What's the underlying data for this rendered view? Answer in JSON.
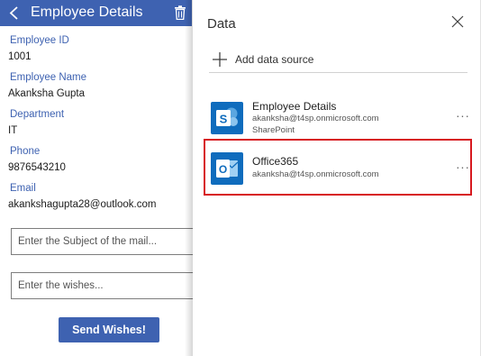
{
  "app": {
    "title": "Employee Details",
    "fields": [
      {
        "label": "Employee ID",
        "value": "1001"
      },
      {
        "label": "Employee Name",
        "value": "Akanksha Gupta"
      },
      {
        "label": "Department",
        "value": "IT"
      },
      {
        "label": "Phone",
        "value": "9876543210"
      },
      {
        "label": "Email",
        "value": "akankshagupta28@outlook.com"
      }
    ],
    "subject_input": {
      "placeholder": "Enter the Subject of the mail...",
      "value": ""
    },
    "wishes_input": {
      "placeholder": "Enter the wishes...",
      "value": ""
    },
    "send_button": "Send Wishes!",
    "header_color": "#3e62b1"
  },
  "panel": {
    "title": "Data",
    "add_source_label": "Add data source",
    "sources": [
      {
        "name": "Employee Details",
        "account": "akanksha@t4sp.onmicrosoft.com",
        "type": "SharePoint",
        "icon": "sharepoint-icon",
        "more": "···"
      },
      {
        "name": "Office365",
        "account": "akanksha@t4sp.onmicrosoft.com",
        "type": "",
        "icon": "outlook-icon",
        "more": "···",
        "highlighted": true
      }
    ],
    "highlight_color": "#d7191f"
  }
}
